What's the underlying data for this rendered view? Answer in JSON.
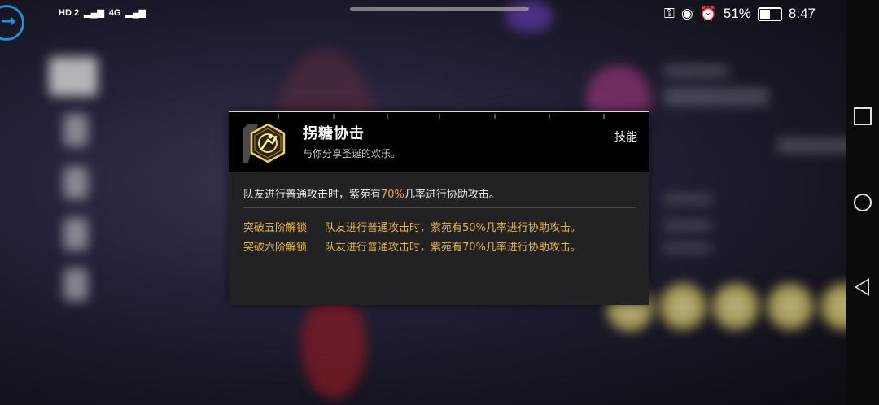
{
  "status": {
    "signal_left": "HD 2",
    "network": "4G",
    "battery_percent": "51%",
    "time": "8:47"
  },
  "popup": {
    "skill_name": "拐糖协击",
    "skill_subtitle": "与你分享圣诞的欢乐。",
    "skill_type": "技能",
    "description": {
      "prefix": "队友进行普通攻击时，紫苑有",
      "value": "70%",
      "suffix": "几率进行协助攻击。"
    },
    "unlocks": [
      {
        "tag": "突破五阶解锁",
        "prefix": "队友进行普通攻击时，紫苑有",
        "value": "50%",
        "suffix": "几率进行协助攻击。"
      },
      {
        "tag": "突破六阶解锁",
        "prefix": "队友进行普通攻击时，紫苑有",
        "value": "70%",
        "suffix": "几率进行协助攻击。"
      }
    ]
  },
  "colors": {
    "accent_gold": "#e3b54a",
    "value_orange": "#f0a040",
    "back_blue": "#1e8fd8"
  },
  "icons": {
    "skill": "skill-emblem-icon",
    "back": "back-arrow-icon",
    "battery": "battery-icon",
    "key": "key-icon",
    "eye": "eye-icon",
    "alarm": "alarm-icon"
  }
}
